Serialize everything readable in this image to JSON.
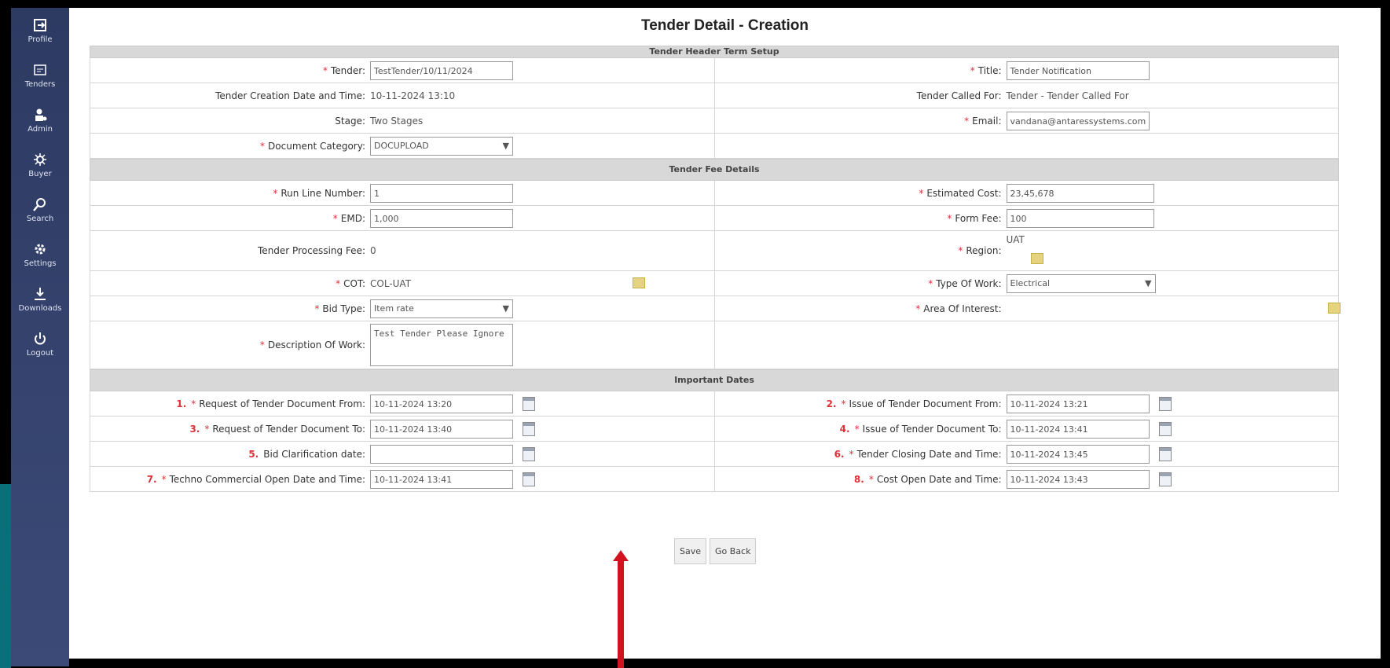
{
  "page_title": "Tender Detail - Creation",
  "sidebar": {
    "items": [
      {
        "label": "Profile",
        "icon": "profile-icon"
      },
      {
        "label": "Tenders",
        "icon": "tender-icon"
      },
      {
        "label": "Admin",
        "icon": "admin-icon"
      },
      {
        "label": "Buyer",
        "icon": "buyer-icon"
      },
      {
        "label": "Search",
        "icon": "search-icon"
      },
      {
        "label": "Settings",
        "icon": "settings-icon"
      },
      {
        "label": "Downloads",
        "icon": "download-icon"
      },
      {
        "label": "Logout",
        "icon": "logout-icon"
      }
    ]
  },
  "sections": {
    "header_term_setup": "Tender Header Term Setup",
    "fee_details": "Tender Fee Details",
    "important_dates": "Important Dates"
  },
  "header": {
    "tender_label": "Tender:",
    "tender_value": "TestTender/10/11/2024",
    "title_label": "Title:",
    "title_value": "Tender Notification",
    "creation_label": "Tender Creation Date and Time:",
    "creation_value": "10-11-2024 13:10",
    "called_for_label": "Tender Called For:",
    "called_for_value": "Tender - Tender Called For",
    "stage_label": "Stage:",
    "stage_value": "Two Stages",
    "email_label": "Email:",
    "email_value": "vandana@antaressystems.com",
    "doc_category_label": "Document Category:",
    "doc_category_value": "DOCUPLOAD"
  },
  "fees": {
    "run_line_label": "Run Line Number:",
    "run_line_value": "1",
    "estimated_label": "Estimated Cost:",
    "estimated_value": "23,45,678",
    "emd_label": "EMD:",
    "emd_value": "1,000",
    "form_fee_label": "Form Fee:",
    "form_fee_value": "100",
    "processing_label": "Tender Processing Fee:",
    "processing_value": "0",
    "region_label": "Region:",
    "region_value": "UAT",
    "cot_label": "COT:",
    "cot_value": "COL-UAT",
    "work_type_label": "Type Of Work:",
    "work_type_value": "Electrical",
    "bid_type_label": "Bid Type:",
    "bid_type_value": "Item rate",
    "area_label": "Area Of Interest:",
    "desc_label": "Description Of Work:",
    "desc_value": "Test Tender Please Ignore"
  },
  "dates": [
    {
      "n": "1.",
      "label": "Request of Tender Document From:",
      "value": "10-11-2024 13:20",
      "required": true
    },
    {
      "n": "2.",
      "label": "Issue of Tender Document From:",
      "value": "10-11-2024 13:21",
      "required": true
    },
    {
      "n": "3.",
      "label": "Request of Tender Document To:",
      "value": "10-11-2024 13:40",
      "required": true
    },
    {
      "n": "4.",
      "label": "Issue of Tender Document To:",
      "value": "10-11-2024 13:41",
      "required": true
    },
    {
      "n": "5.",
      "label": "Bid Clarification date:",
      "value": "",
      "required": false
    },
    {
      "n": "6.",
      "label": "Tender Closing Date and Time:",
      "value": "10-11-2024 13:45",
      "required": true
    },
    {
      "n": "7.",
      "label": "Techno Commercial Open Date and Time:",
      "value": "10-11-2024 13:41",
      "required": true
    },
    {
      "n": "8.",
      "label": "Cost Open Date and Time:",
      "value": "10-11-2024 13:43",
      "required": true
    }
  ],
  "buttons": {
    "save": "Save",
    "back": "Go Back"
  },
  "colors": {
    "sidebar": "#2d3a62",
    "required": "#e0303a",
    "arrow": "#d3121f"
  }
}
